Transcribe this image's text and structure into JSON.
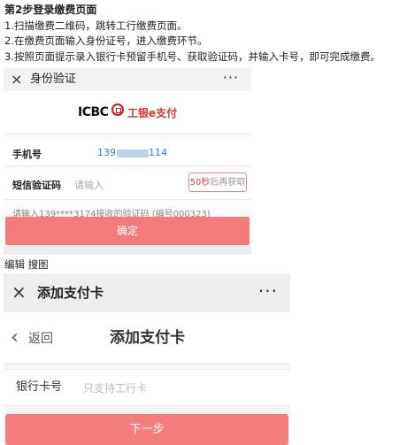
{
  "instructions": {
    "title": "第2步登录缴费页面",
    "steps": [
      "1.扫描缴费二维码，跳转工行缴费页面。",
      "2.在缴费页面输入身份证号，进入缴费环节。",
      "3.按照页面提示录入银行卡预留手机号、获取验证码，并输入卡号，即可完成缴费。"
    ]
  },
  "screen1": {
    "close_icon": "×",
    "title": "身份验证",
    "menu_icon": "···",
    "brand": {
      "icbc_text": "ICBC",
      "pay_text": "工银e支付",
      "accent": "#c81e1e"
    },
    "phone": {
      "label": "手机号",
      "value_visible": "139",
      "value_tail": "114"
    },
    "sms": {
      "label": "短信验证码",
      "placeholder": "请输入",
      "resend_seconds": "50秒",
      "resend_text": "后再获取"
    },
    "hint": "请输入139****3174接收的验证码 (编号000323)",
    "confirm_button": "确定",
    "button_color": "#f47b7b"
  },
  "caption": "编辑 搜图",
  "screen2": {
    "close_icon": "×",
    "title": "添加支付卡",
    "menu_icon": "···",
    "back_icon": "‹",
    "back_label": "返回",
    "nav_title": "添加支付卡",
    "card": {
      "label": "银行卡号",
      "placeholder": "只支持工行卡"
    },
    "next_button": "下一步",
    "button_color": "#f47e7e"
  }
}
